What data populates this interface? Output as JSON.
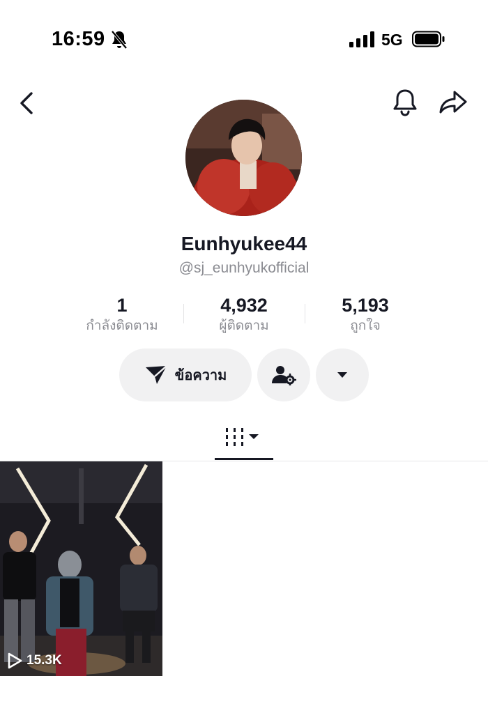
{
  "status_bar": {
    "time": "16:59",
    "network": "5G",
    "icons": [
      "bell-slash-icon",
      "signal-icon",
      "battery-icon"
    ]
  },
  "nav": {
    "icons": [
      "back-arrow-icon",
      "bell-icon",
      "share-arrow-icon"
    ]
  },
  "profile": {
    "display_name": "Eunhyukee44",
    "handle": "@sj_eunhyukofficial",
    "stats": [
      {
        "value": "1",
        "label": "กำลังติดตาม"
      },
      {
        "value": "4,932",
        "label": "ผู้ติดตาม"
      },
      {
        "value": "5,193",
        "label": "ถูกใจ"
      }
    ]
  },
  "actions": {
    "message_label": "ข้อความ",
    "icons": [
      "send-icon",
      "user-settings-icon",
      "caret-down-icon"
    ]
  },
  "tabs": {
    "grid_icon": "video-grid-icon"
  },
  "videos": [
    {
      "views": "15.3K"
    }
  ],
  "colors": {
    "text": "#161823",
    "muted": "#8a8b91",
    "button_bg": "#f1f1f2"
  }
}
